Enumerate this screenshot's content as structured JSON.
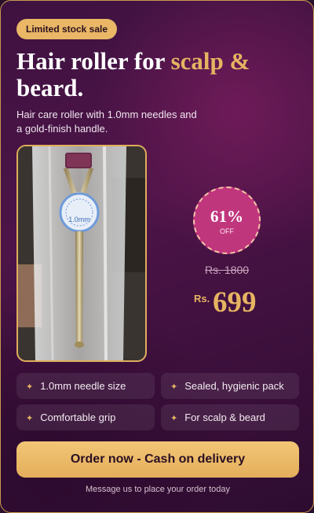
{
  "tag": {
    "label": "Limited stock sale"
  },
  "headline": {
    "part1": "Hair roller for ",
    "accent": "scalp &",
    "part2": "beard."
  },
  "description": "Hair care roller with 1.0mm needles and a gold-finish handle.",
  "product_image": {
    "label_text": "1.0mm"
  },
  "discount": {
    "percent": "61%",
    "off_label": "OFF"
  },
  "price": {
    "original": "Rs. 1800",
    "currency": "Rs.",
    "current": "699"
  },
  "features": [
    {
      "icon": "sparkle-icon",
      "label": "1.0mm needle size"
    },
    {
      "icon": "sparkle-icon",
      "label": "Sealed, hygienic pack"
    },
    {
      "icon": "sparkle-icon",
      "label": "Comfortable grip"
    },
    {
      "icon": "sparkle-icon",
      "label": "For scalp & beard"
    }
  ],
  "cta": {
    "label": "Order now - Cash on delivery"
  },
  "footnote": "Message us to place your order today",
  "colors": {
    "accent_gold": "#e6b462",
    "badge_pink": "#c0367d",
    "background_purple": "#4d1448"
  }
}
